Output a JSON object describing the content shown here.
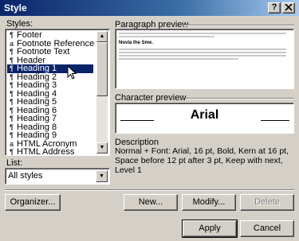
{
  "window": {
    "title": "Style",
    "help_button": "?",
    "close_button": "x"
  },
  "styles": {
    "label": "Styles:",
    "items": [
      {
        "marker": "¶",
        "label": "Footer"
      },
      {
        "marker": "a",
        "label": "Footnote Reference"
      },
      {
        "marker": "¶",
        "label": "Footnote Text"
      },
      {
        "marker": "¶",
        "label": "Header"
      },
      {
        "marker": "¶",
        "label": "Heading 1",
        "selected": true
      },
      {
        "marker": "¶",
        "label": "Heading 2"
      },
      {
        "marker": "¶",
        "label": "Heading 3"
      },
      {
        "marker": "¶",
        "label": "Heading 4"
      },
      {
        "marker": "¶",
        "label": "Heading 5"
      },
      {
        "marker": "¶",
        "label": "Heading 6"
      },
      {
        "marker": "¶",
        "label": "Heading 7"
      },
      {
        "marker": "¶",
        "label": "Heading 8"
      },
      {
        "marker": "¶",
        "label": "Heading 9"
      },
      {
        "marker": "a",
        "label": "HTML Acronym"
      },
      {
        "marker": "¶",
        "label": "HTML Address"
      }
    ],
    "scroll_up": "▲",
    "scroll_down": "▼"
  },
  "list_filter": {
    "label": "List:",
    "value": "All styles",
    "arrow": "▼"
  },
  "paragraph_preview": {
    "label": "Paragraph preview",
    "heading_sample": "Novla the Sme."
  },
  "character_preview": {
    "label": "Character preview",
    "sample": "Arial"
  },
  "description": {
    "label": "Description",
    "text": "Normal + Font: Arial, 16 pt, Bold, Kern at 16 pt, Space before 12 pt  after 3 pt, Keep with next, Level 1"
  },
  "buttons": {
    "organizer": "Organizer...",
    "new": "New...",
    "modify": "Modify...",
    "delete": "Delete",
    "apply": "Apply",
    "cancel": "Cancel"
  }
}
